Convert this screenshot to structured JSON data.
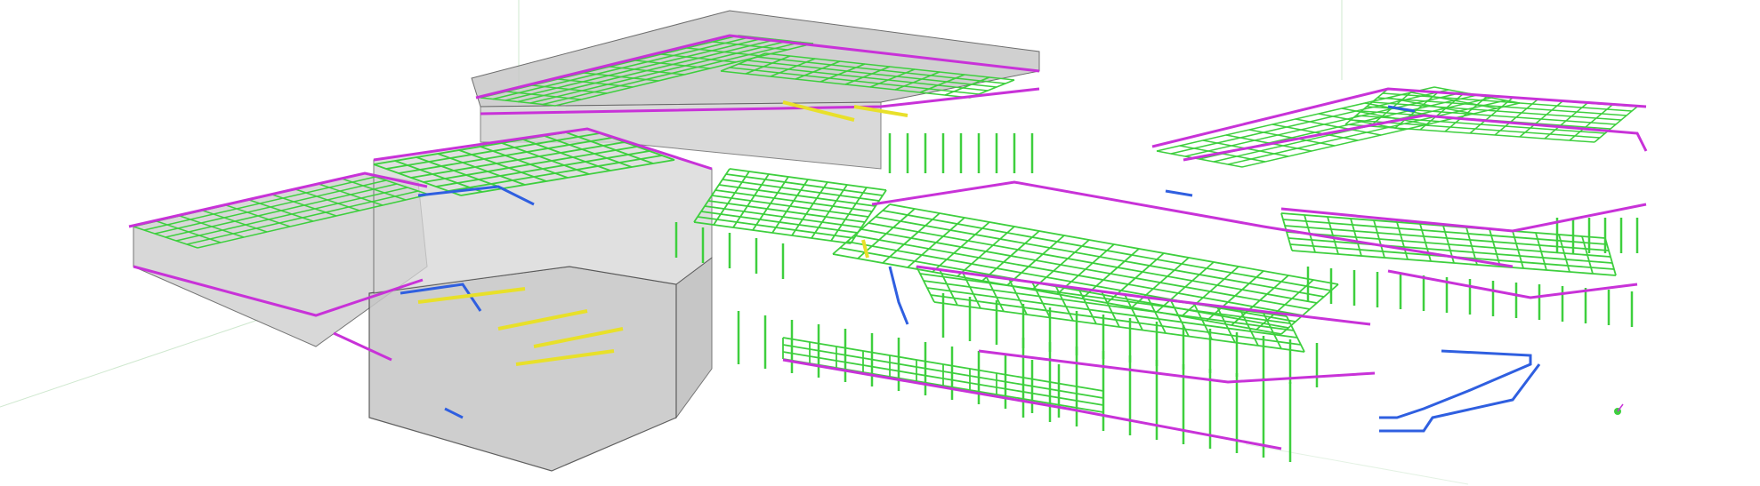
{
  "viewport": {
    "background": "#ffffff"
  },
  "model": {
    "view": "3d-isometric",
    "render_style": "wireframe-with-transparent-walls",
    "disciplines": [
      {
        "key": "structure",
        "color": "#3ecf3e"
      },
      {
        "key": "architecture",
        "color": "#c832d8"
      },
      {
        "key": "ducts",
        "color": "#2f5fe0"
      },
      {
        "key": "pipes",
        "color": "#e8e02a"
      },
      {
        "key": "enclosure",
        "color": "#9a9a9a"
      }
    ],
    "axis_colors": {
      "x": "#c9e6c9",
      "y": "#c9e6c9",
      "z": "#c9e6c9"
    }
  }
}
